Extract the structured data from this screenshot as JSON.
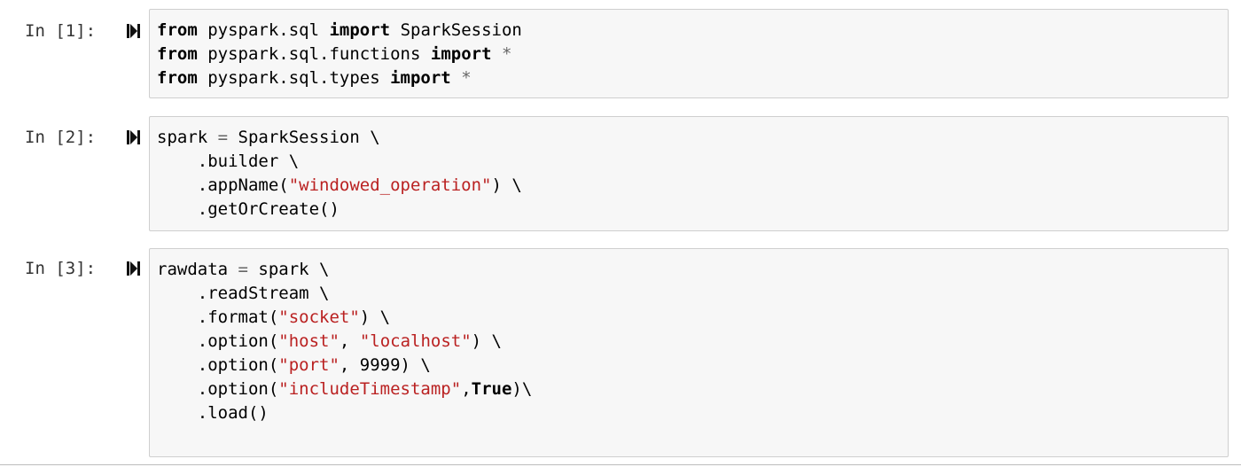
{
  "cells": [
    {
      "prompt": "In [1]:",
      "lines": [
        [
          {
            "t": "from",
            "s": "kw"
          },
          {
            "t": " pyspark.sql ",
            "s": ""
          },
          {
            "t": "import",
            "s": "kw"
          },
          {
            "t": " SparkSession",
            "s": ""
          }
        ],
        [
          {
            "t": "from",
            "s": "kw"
          },
          {
            "t": " pyspark.sql.functions ",
            "s": ""
          },
          {
            "t": "import",
            "s": "kw"
          },
          {
            "t": " ",
            "s": ""
          },
          {
            "t": "*",
            "s": "op"
          }
        ],
        [
          {
            "t": "from",
            "s": "kw"
          },
          {
            "t": " pyspark.sql.types ",
            "s": ""
          },
          {
            "t": "import",
            "s": "kw"
          },
          {
            "t": " ",
            "s": ""
          },
          {
            "t": "*",
            "s": "op"
          }
        ]
      ]
    },
    {
      "prompt": "In [2]:",
      "lines": [
        [
          {
            "t": "spark ",
            "s": ""
          },
          {
            "t": "=",
            "s": "op"
          },
          {
            "t": " SparkSession \\",
            "s": ""
          }
        ],
        [
          {
            "t": "    .builder \\",
            "s": ""
          }
        ],
        [
          {
            "t": "    .appName(",
            "s": ""
          },
          {
            "t": "\"windowed_operation\"",
            "s": "str"
          },
          {
            "t": ") \\",
            "s": ""
          }
        ],
        [
          {
            "t": "    .getOrCreate()",
            "s": ""
          }
        ]
      ]
    },
    {
      "prompt": "In [3]:",
      "lines": [
        [
          {
            "t": "rawdata ",
            "s": ""
          },
          {
            "t": "=",
            "s": "op"
          },
          {
            "t": " spark \\",
            "s": ""
          }
        ],
        [
          {
            "t": "    .readStream \\",
            "s": ""
          }
        ],
        [
          {
            "t": "    .format(",
            "s": ""
          },
          {
            "t": "\"socket\"",
            "s": "str"
          },
          {
            "t": ") \\",
            "s": ""
          }
        ],
        [
          {
            "t": "    .option(",
            "s": ""
          },
          {
            "t": "\"host\"",
            "s": "str"
          },
          {
            "t": ", ",
            "s": ""
          },
          {
            "t": "\"localhost\"",
            "s": "str"
          },
          {
            "t": ") \\",
            "s": ""
          }
        ],
        [
          {
            "t": "    .option(",
            "s": ""
          },
          {
            "t": "\"port\"",
            "s": "str"
          },
          {
            "t": ", 9999) \\",
            "s": ""
          }
        ],
        [
          {
            "t": "    .option(",
            "s": ""
          },
          {
            "t": "\"includeTimestamp\"",
            "s": "str"
          },
          {
            "t": ",",
            "s": ""
          },
          {
            "t": "True",
            "s": "kw"
          },
          {
            "t": ")\\",
            "s": ""
          }
        ],
        [
          {
            "t": "    .load()",
            "s": ""
          }
        ]
      ]
    }
  ],
  "icons": {
    "run": "run-cell-icon"
  }
}
